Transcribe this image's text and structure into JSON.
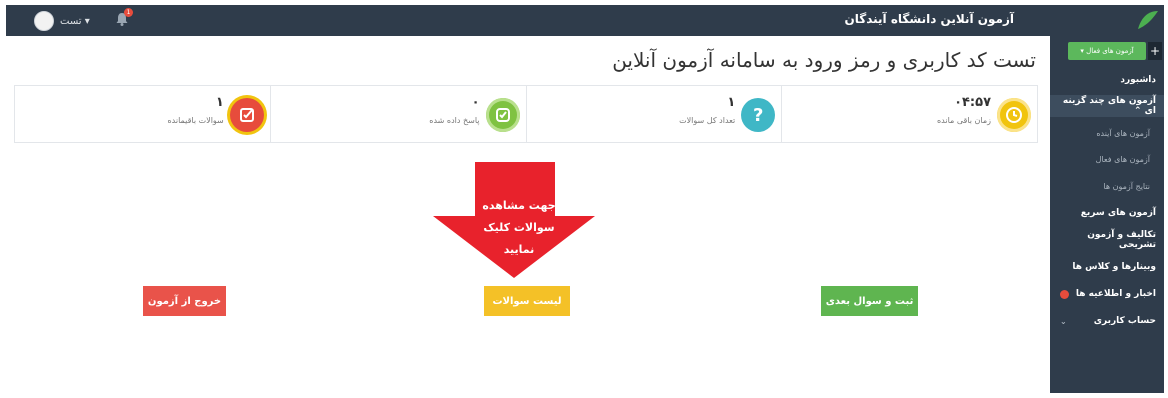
{
  "header": {
    "site_title": "آزمون آنلاین دانشگاه آیندگان",
    "user_name": "تست ▾",
    "bell_badge": "1"
  },
  "sidebar": {
    "active_exams_button": "آزمون های فعال ▾",
    "plus": "+",
    "items": [
      {
        "label": "داشبورد",
        "type": "main"
      },
      {
        "label": "آزمون های چند گزینه ای ⌃",
        "type": "open"
      },
      {
        "label": "آزمون های آینده",
        "type": "sub"
      },
      {
        "label": "آزمون های فعال",
        "type": "sub"
      },
      {
        "label": "نتایج آزمون ها",
        "type": "sub"
      },
      {
        "label": "آزمون های سریع",
        "type": "main"
      },
      {
        "label": "تکالیف و آزمون تشریحی",
        "type": "main"
      },
      {
        "label": "وبینارها و کلاس ها",
        "type": "main"
      },
      {
        "label": "اخبار و اطلاعیه ها",
        "type": "main"
      },
      {
        "label": "حساب کاربری",
        "type": "main"
      }
    ]
  },
  "page": {
    "title": "تست کد کاربری و رمز ورود به سامانه آزمون آنلاین"
  },
  "stats": [
    {
      "value": "۰۴:۵۷",
      "label": "زمان باقی مانده",
      "color": "#f1c40f",
      "icon": "clock-icon"
    },
    {
      "value": "۱",
      "label": "تعداد کل سوالات",
      "color": "#3fb7c6",
      "icon": "question-icon"
    },
    {
      "value": "۰",
      "label": "پاسخ داده شده",
      "color": "#7fc241",
      "icon": "check-icon"
    },
    {
      "value": "۱",
      "label": "سوالات باقیمانده",
      "color": "#e74c3c",
      "icon": "checkbox-icon"
    }
  ],
  "annotation": {
    "line1": "جهت مشاهده",
    "line2": "سوالات کلیک نمایید"
  },
  "buttons": {
    "exit": "خروج از آزمون",
    "question_list": "لیست سوالات",
    "save_next": "ثبت و سوال بعدی"
  }
}
